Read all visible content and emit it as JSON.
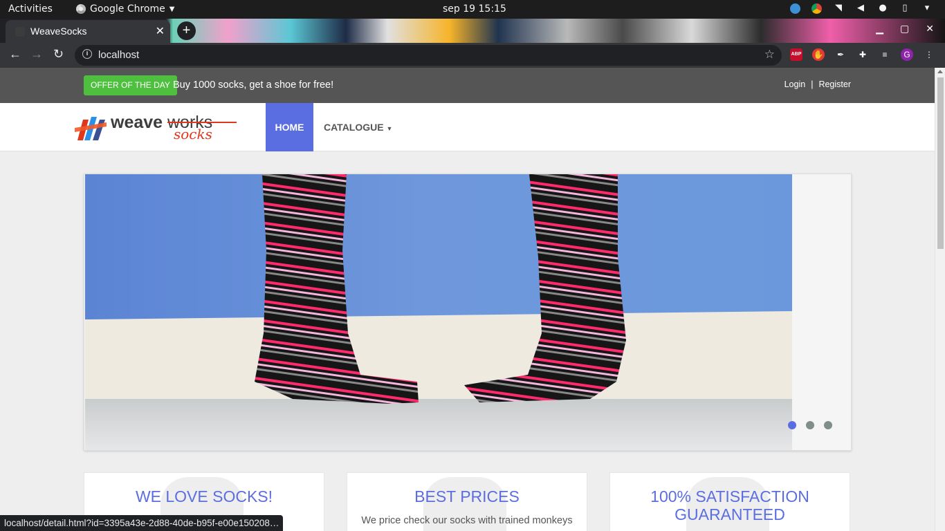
{
  "os": {
    "activities": "Activities",
    "app_name": "Google Chrome",
    "clock": "sep 19  15:15"
  },
  "browser": {
    "tab_title": "WeaveSocks",
    "url": "localhost",
    "ext_abp": "ABP",
    "profile_initial": "G",
    "status_url": "localhost/detail.html?id=3395a43e-2d88-40de-b95f-e00e150208…"
  },
  "site": {
    "offer_badge": "OFFER OF THE DAY",
    "offer_text": "Buy 1000 socks, get a shoe for free!",
    "login": "Login",
    "separator": "|",
    "register": "Register",
    "logo_text_1": "weave",
    "logo_text_2": "works",
    "logo_text_3": "socks",
    "nav_home": "HOME",
    "nav_catalogue": "CATALOGUE",
    "carousel": {
      "slides": 3,
      "active": 1
    },
    "cards": [
      {
        "title": "WE LOVE SOCKS!",
        "text": ""
      },
      {
        "title": "BEST PRICES",
        "text": "We price check our socks with trained monkeys"
      },
      {
        "title": "100% SATISFACTION GUARANTEED",
        "text": ""
      }
    ]
  },
  "colors": {
    "accent": "#5b6ee1",
    "offer_green": "#4fbf40",
    "topbar": "#555555"
  }
}
